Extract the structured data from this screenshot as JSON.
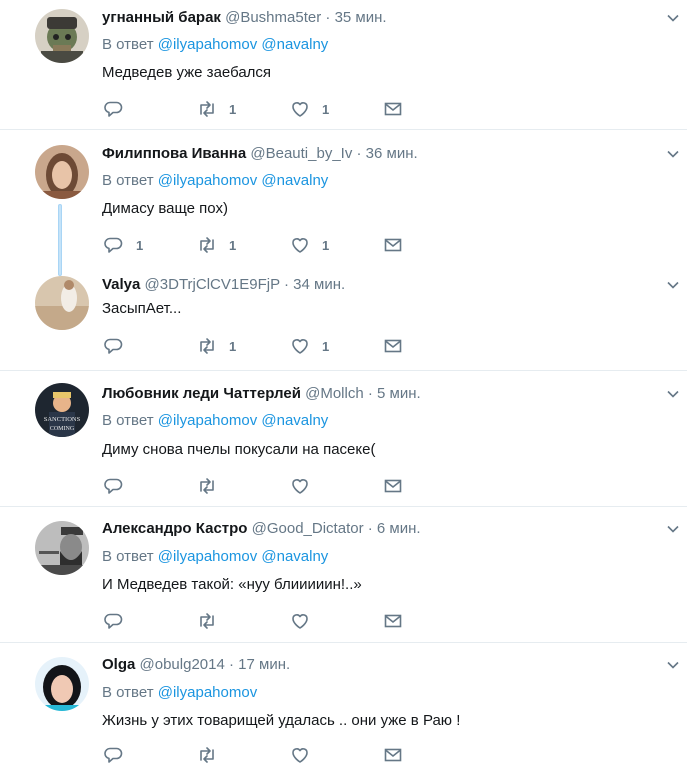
{
  "reply_prefix": "В ответ",
  "tweets": [
    {
      "name": "угнанный барак",
      "handle": "@Bushma5ter",
      "time": "35 мин.",
      "reply_to": [
        "@ilyapahomov",
        "@navalny"
      ],
      "text": "Медведев уже заебался",
      "replies": "",
      "retweets": "1",
      "likes": "1"
    },
    {
      "name": "Филиппова Иванна",
      "handle": "@Beauti_by_Iv",
      "time": "36 мин.",
      "reply_to": [
        "@ilyapahomov",
        "@navalny"
      ],
      "text": "Димасу  ваще пох)",
      "replies": "1",
      "retweets": "1",
      "likes": "1"
    },
    {
      "name": "Valya",
      "handle": "@3DTrjClCV1E9FjP",
      "time": "34 мин.",
      "reply_to": [],
      "text": "ЗасыпАет...",
      "replies": "",
      "retweets": "1",
      "likes": "1"
    },
    {
      "name": "Любовник леди Чаттерлей",
      "handle": "@Mollch",
      "time": "5 мин.",
      "reply_to": [
        "@ilyapahomov",
        "@navalny"
      ],
      "text": "Диму снова пчелы покусали на пасеке(",
      "replies": "",
      "retweets": "",
      "likes": "",
      "avatar_text": [
        "SANCTIONS",
        "COMING"
      ]
    },
    {
      "name": "Александро Кастро",
      "handle": "@Good_Dictator",
      "time": "6 мин.",
      "reply_to": [
        "@ilyapahomov",
        "@navalny"
      ],
      "text": "И Медведев такой: «нуу блииииин!..»",
      "replies": "",
      "retweets": "",
      "likes": ""
    },
    {
      "name": "Olga",
      "handle": "@obulg2014",
      "time": "17 мин.",
      "reply_to": [
        "@ilyapahomov"
      ],
      "text": "Жизнь у этих товарищей удалась .. они уже в Раю !",
      "replies": "",
      "retweets": "",
      "likes": ""
    }
  ],
  "colors": {
    "link": "#1b95e0",
    "muted": "#657786",
    "thread": "#c4e3f9"
  }
}
